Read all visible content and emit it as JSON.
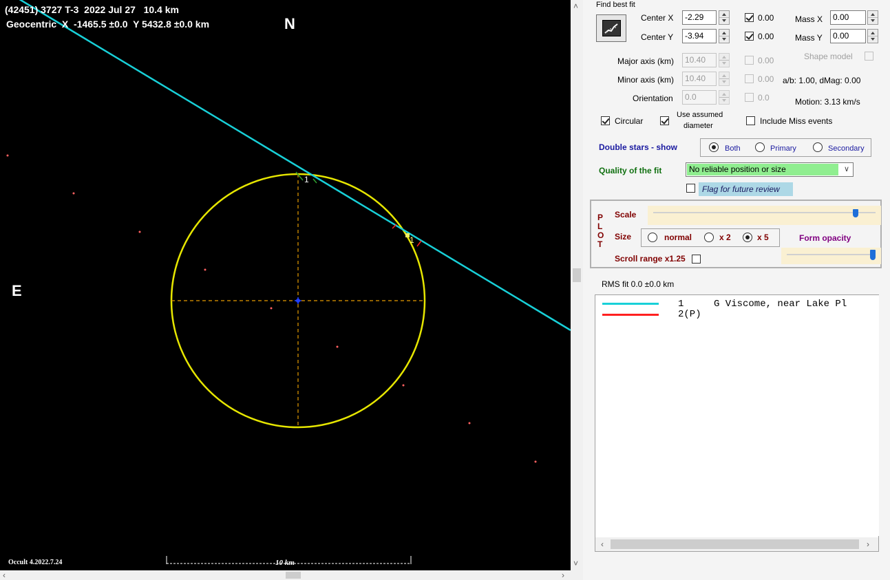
{
  "plot": {
    "title_line": "(42451) 3727 T-3  2022 Jul 27   10.4 km",
    "geocentric_line": "Geocentric  X  -1465.5 ±0.0  Y 5432.8 ±0.0 km",
    "north_label": "N",
    "east_label": "E",
    "chord_marker_1": "1",
    "chord_marker_2": "1",
    "credit": "Occult 4.2022.7.24",
    "scale_bar_label": "10 km",
    "colors": {
      "background": "#000000",
      "ellipse": "#e6e600",
      "axes": "#e69b00",
      "chord_positive": "#18d0d8",
      "chord_miss": "#ff2020",
      "stars": "#ff6060",
      "center": "#2040ff"
    }
  },
  "panel": {
    "find_best_fit_label": "Find best fit",
    "fit_button_icon": "chart-fit-icon",
    "center_x": {
      "label": "Center X",
      "value": "-2.29",
      "fit_checked": true,
      "fit_value": "0.00"
    },
    "center_y": {
      "label": "Center Y",
      "value": "-3.94",
      "fit_checked": true,
      "fit_value": "0.00"
    },
    "mass_x": {
      "label": "Mass X",
      "value": "0.00"
    },
    "mass_y": {
      "label": "Mass Y",
      "value": "0.00"
    },
    "major_axis": {
      "label": "Major axis (km)",
      "value": "10.40",
      "fit_value": "0.00"
    },
    "minor_axis": {
      "label": "Minor axis (km)",
      "value": "10.40",
      "fit_value": "0.00"
    },
    "orientation": {
      "label": "Orientation",
      "value": "0.0",
      "fit_value": "0.0"
    },
    "shape_model_label": "Shape model",
    "ab_text": "a/b: 1.00, dMag: 0.00",
    "motion_text": "Motion: 3.13 km/s",
    "circular_label": "Circular",
    "use_assumed_label": "Use assumed",
    "use_assumed_label2": "diameter",
    "include_miss_label": "Include Miss events",
    "double_stars_label": "Double stars - show",
    "double_options": [
      "Both",
      "Primary",
      "Secondary"
    ],
    "double_selected": "Both",
    "quality_label": "Quality of the fit",
    "quality_value": "No reliable position or size",
    "flag_label": "Flag for future review",
    "plot_letters": [
      "P",
      "L",
      "O",
      "T"
    ],
    "scale_label": "Scale",
    "scale_level": 0.92,
    "size_label": "Size",
    "size_options": [
      "normal",
      "x 2",
      "x 5"
    ],
    "size_selected": "x 5",
    "form_opacity_label": "Form opacity",
    "opacity_level": 1.0,
    "scroll_range_label": "Scroll range x1.25",
    "rms_text": "RMS fit 0.0 ±0.0 km",
    "legend": [
      {
        "id": "1",
        "text": "G Viscome, near Lake Pl",
        "color": "#18d0d8"
      },
      {
        "id": "2(P)",
        "text": "",
        "color": "#ff2020"
      }
    ]
  }
}
